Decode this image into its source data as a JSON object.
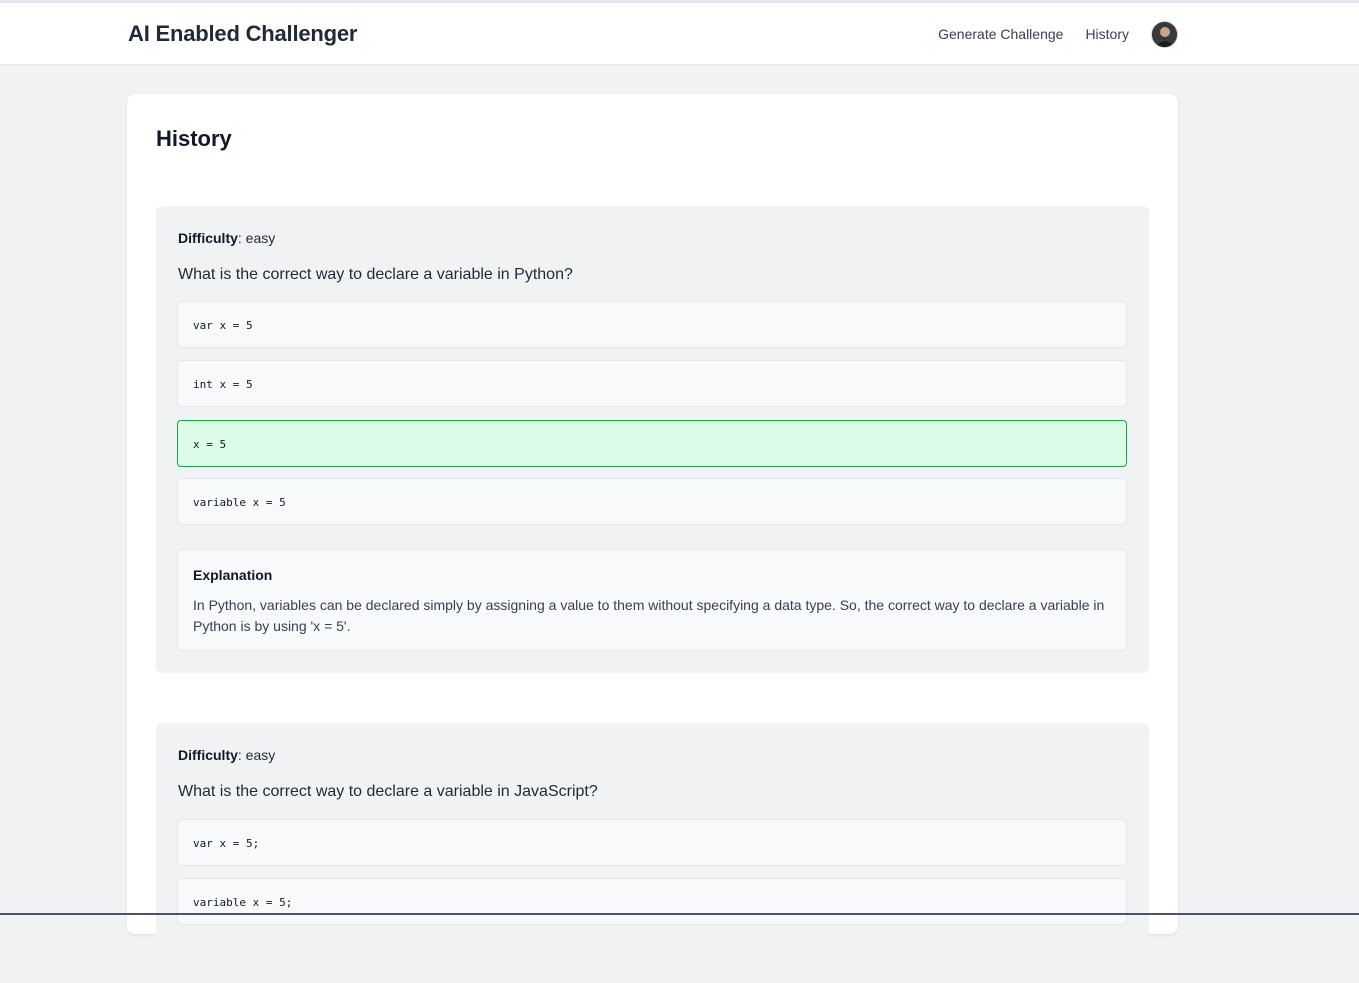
{
  "header": {
    "brand": "AI Enabled Challenger",
    "nav": [
      {
        "label": "Generate Challenge"
      },
      {
        "label": "History"
      }
    ],
    "avatar_icon": "user-avatar"
  },
  "page": {
    "title": "History"
  },
  "challenges": [
    {
      "difficulty_label": "Difficulty",
      "difficulty": ": easy",
      "question": "What is the correct way to declare a variable in Python?",
      "options": [
        "var x = 5",
        "int x = 5",
        "x = 5",
        "variable x = 5"
      ],
      "correct_index": 2,
      "explanation_title": "Explanation",
      "explanation": "In Python, variables can be declared simply by assigning a value to them without specifying a data type. So, the correct way to declare a variable in Python is by using 'x = 5'."
    },
    {
      "difficulty_label": "Difficulty",
      "difficulty": ": easy",
      "question": "What is the correct way to declare a variable in JavaScript?",
      "options": [
        "var x = 5;",
        "variable x = 5;"
      ]
    }
  ],
  "colors": {
    "correct_bg": "#dcfce7",
    "correct_border": "#16a34a"
  }
}
